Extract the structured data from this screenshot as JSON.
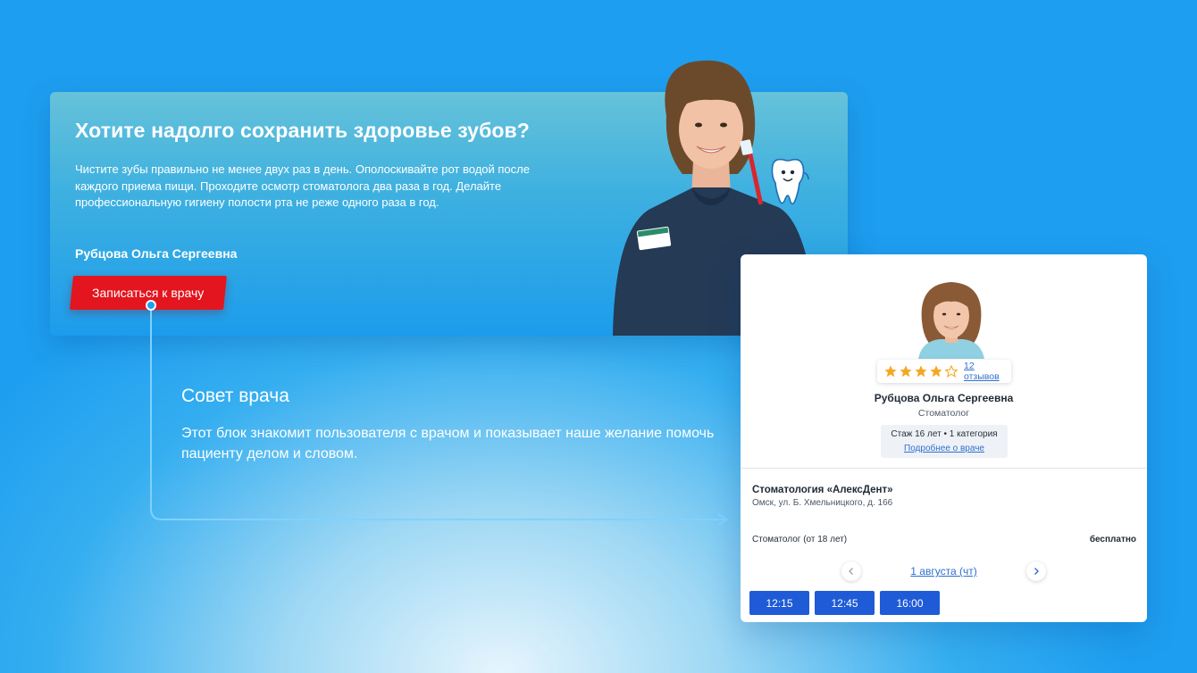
{
  "hero": {
    "title": "Хотите надолго сохранить здоровье зубов?",
    "text": "Чистите зубы правильно не менее двух раз в день. Ополоскивайте рот водой после каждого приема пищи. Проходите осмотр стоматолога два раза в год. Делайте профессиональную гигиену полости рта не реже одного раза в год.",
    "doctor_name": "Рубцова Ольга Сергеевна",
    "button_label": "Записаться к врачу"
  },
  "advice": {
    "title": "Совет врача",
    "text": "Этот блок знакомит пользователя с врачом и показывает наше желание помочь пациенту делом и словом."
  },
  "card": {
    "rating": 4,
    "rating_max": 5,
    "reviews_label": "12 отзывов",
    "doctor_name": "Рубцова Ольга Сергеевна",
    "specialty": "Стоматолог",
    "experience": "Стаж 16 лет • 1 категория",
    "profile_link": "Подробнее о враче",
    "clinic_name": "Стоматология «АлексДент»",
    "clinic_address": "Омск, ул. Б. Хмельницкого, д. 166",
    "service": "Стоматолог (от 18 лет)",
    "price": "бесплатно",
    "date": "1 августа (чт)",
    "slots": [
      "12:15",
      "12:45",
      "16:00"
    ]
  },
  "colors": {
    "background": "#1e9ef0",
    "accent_red": "#e3151f",
    "slot_blue": "#1f5bd6",
    "link_blue": "#2f6fd0",
    "star": "#f5a623"
  },
  "icons": [
    "toothbrush-tooth-mascot-icon",
    "star-icon",
    "chevron-left-icon",
    "chevron-right-icon",
    "arrow-right-icon"
  ]
}
